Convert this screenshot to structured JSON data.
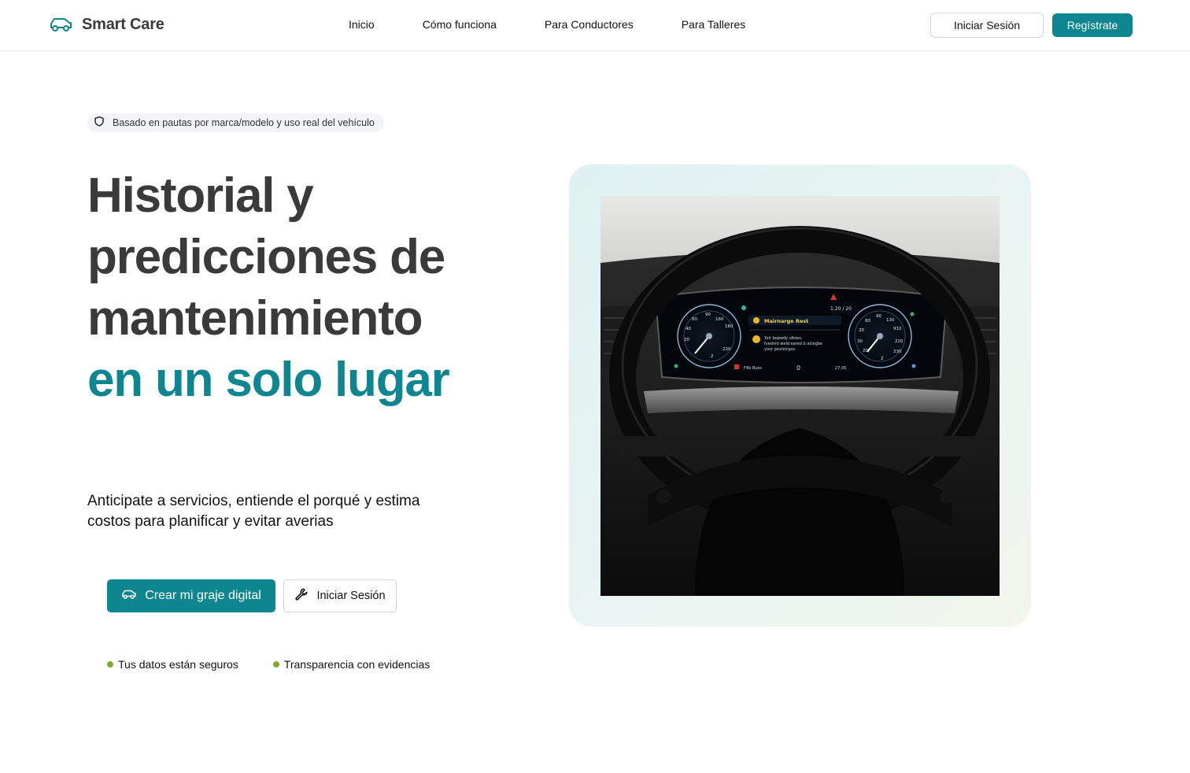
{
  "header": {
    "brand": "Smart Care",
    "nav": [
      "Inicio",
      "Cómo funciona",
      "Para Conductores",
      "Para Talleres"
    ],
    "login_label": "Iniciar Sesión",
    "register_label": "Regístrate"
  },
  "hero": {
    "badge": "Basado en pautas por marca/modelo y uso real del vehículo",
    "headline_line1": "Historial y",
    "headline_line2": "predicciones de",
    "headline_line3": "mantenimiento",
    "headline_accent": "en un solo lugar",
    "subtitle": "Anticipate a servicios, entiende el porqué y estima costos para planificar y evitar averias",
    "cta_primary": "Crear mi graje digital",
    "cta_secondary": "Iniciar Sesión",
    "features": [
      "Tus datos están seguros",
      "Transparencia con evidencias"
    ]
  },
  "dashboard_screen": {
    "alert_title": "Mairnarge Rest",
    "alert_text_1": "Yoir bepwdy oltoes.",
    "alert_text_2": "fvednid weld eared b alcegbe",
    "alert_text_3": "your pesteirgas.",
    "left_gauge_ticks": [
      "60",
      "90",
      "160",
      "160",
      "40",
      "20",
      "220",
      "2"
    ],
    "right_gauge_ticks": [
      "80",
      "90",
      "130",
      "20",
      "910",
      "30",
      "220",
      "20",
      "230",
      "2"
    ],
    "top_readout": "1:20 / 20",
    "bottom_left": "F4b Rues",
    "bottom_center": "0",
    "bottom_right": "27.05"
  },
  "colors": {
    "accent": "#0e8690",
    "feature_dot": "#7cab2e",
    "heading": "#3a3a3a"
  },
  "icons": {
    "brand": "car-icon",
    "badge": "shield-icon",
    "cta_primary": "car-icon",
    "cta_secondary": "wrench-icon"
  }
}
